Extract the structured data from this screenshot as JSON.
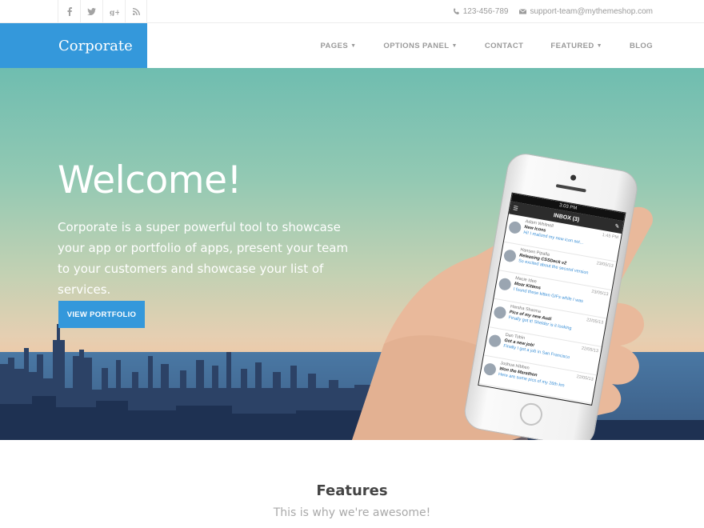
{
  "topbar": {
    "social": [
      {
        "name": "facebook-icon",
        "glyph": "f"
      },
      {
        "name": "twitter-icon",
        "glyph": "t"
      },
      {
        "name": "google-plus-icon",
        "glyph": "g+"
      },
      {
        "name": "rss-icon",
        "glyph": "rss"
      }
    ],
    "phone": "123-456-789",
    "email": "support-team@mythemeshop.com"
  },
  "nav": {
    "logo": "Corporate",
    "items": [
      {
        "label": "PAGES",
        "dropdown": true
      },
      {
        "label": "OPTIONS PANEL",
        "dropdown": true
      },
      {
        "label": "CONTACT",
        "dropdown": false
      },
      {
        "label": "FEATURED",
        "dropdown": true
      },
      {
        "label": "BLOG",
        "dropdown": false
      }
    ],
    "caret": "▼"
  },
  "hero": {
    "title": "Welcome!",
    "text": "Corporate is a super powerful tool to showcase your app or portfolio of apps, present your team to your customers and showcase your list of services.",
    "button": "VIEW PORTFOLIO"
  },
  "phone": {
    "time": "3:03 PM",
    "inbox": "INBOX (3)",
    "messages": [
      {
        "from": "Adam Whitnell",
        "subject": "New Icons",
        "preview": "Hi! I realized my new icon set...",
        "date": "1:45 PM"
      },
      {
        "from": "Hansen Pipalla",
        "subject": "Releasing CSSDeck v2",
        "preview": "So excited about the second version",
        "date": "23/05/13"
      },
      {
        "from": "Macie Idee",
        "subject": "Moar Kittens",
        "preview": "I found these kitten GIFs while I was",
        "date": "23/05/13"
      },
      {
        "from": "Harsha Sharma",
        "subject": "Pics of my new Audi",
        "preview": "Finally got it! Shelder is it looking",
        "date": "22/05/13"
      },
      {
        "from": "Dan Tobin",
        "subject": "Got a new job!",
        "preview": "Finally I got a job in San Francisco",
        "date": "22/05/13"
      },
      {
        "from": "Joshua Hibben",
        "subject": "Won the Marathon",
        "preview": "Here are some pics of my 26th km",
        "date": "22/05/13"
      }
    ]
  },
  "features": {
    "title": "Features",
    "subtitle": "This is why we're awesome!"
  },
  "colors": {
    "accent": "#3498db"
  }
}
